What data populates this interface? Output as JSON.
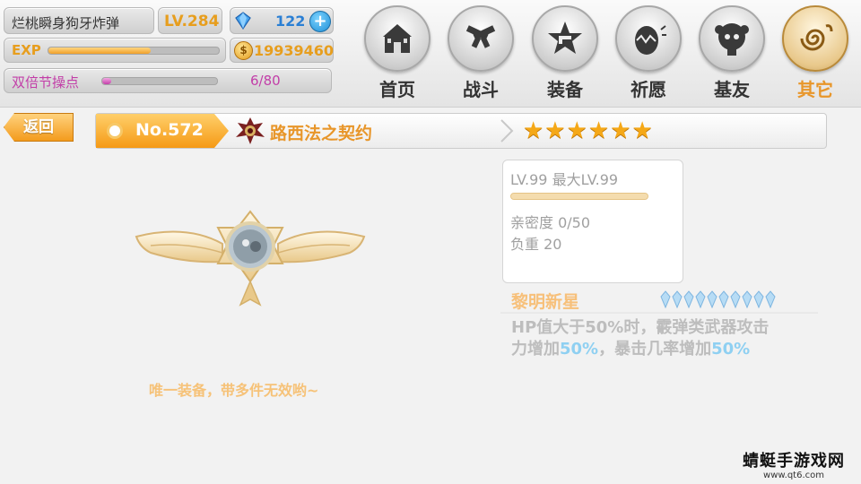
{
  "player": {
    "name": "烂桃瞬身狗牙炸弹",
    "level": "LV.284",
    "gems": "122",
    "gems_add_label": "+",
    "exp_label": "EXP",
    "exp_progress": 0.6,
    "coins": "19939460",
    "coin_symbol": "$",
    "double_label": "双倍节操点",
    "double_value": "6/80",
    "double_progress": 0.075
  },
  "nav": {
    "items": [
      {
        "label": "首页",
        "icon": "castle-icon"
      },
      {
        "label": "战斗",
        "icon": "crossed-guns-icon"
      },
      {
        "label": "装备",
        "icon": "star-gun-icon"
      },
      {
        "label": "祈愿",
        "icon": "egg-icon"
      },
      {
        "label": "基友",
        "icon": "character-face-icon"
      },
      {
        "label": "其它",
        "icon": "spiral-icon"
      }
    ],
    "active_index": 5
  },
  "header": {
    "back_label": "返回",
    "number": "No.572",
    "item_name": "路西法之契约",
    "stars": "★★★★★★",
    "star_count": 6
  },
  "equipment": {
    "unique_note": "唯一装备，带多件无效哟~",
    "level_line": "LV.99 最大LV.99",
    "level_progress": 1.0,
    "affinity": "亲密度 0/50",
    "weight": "负重 20",
    "skill_name": "黎明新星",
    "crystal_count": 10,
    "skill_desc_1": "HP值大于50%时，霰弹类武器攻击",
    "skill_desc_2a": "力增加",
    "skill_desc_2b": "50%",
    "skill_desc_2c": "，暴击几率增加",
    "skill_desc_2d": "50%"
  },
  "colors": {
    "accent_orange": "#e8962a",
    "gem_blue": "#2a7fd4",
    "double_purple": "#c23ea8",
    "highlight_blue": "#8fd0f2"
  },
  "watermark": {
    "main": "蜻蜓手游戏网",
    "sub": "www.qt6.com"
  }
}
